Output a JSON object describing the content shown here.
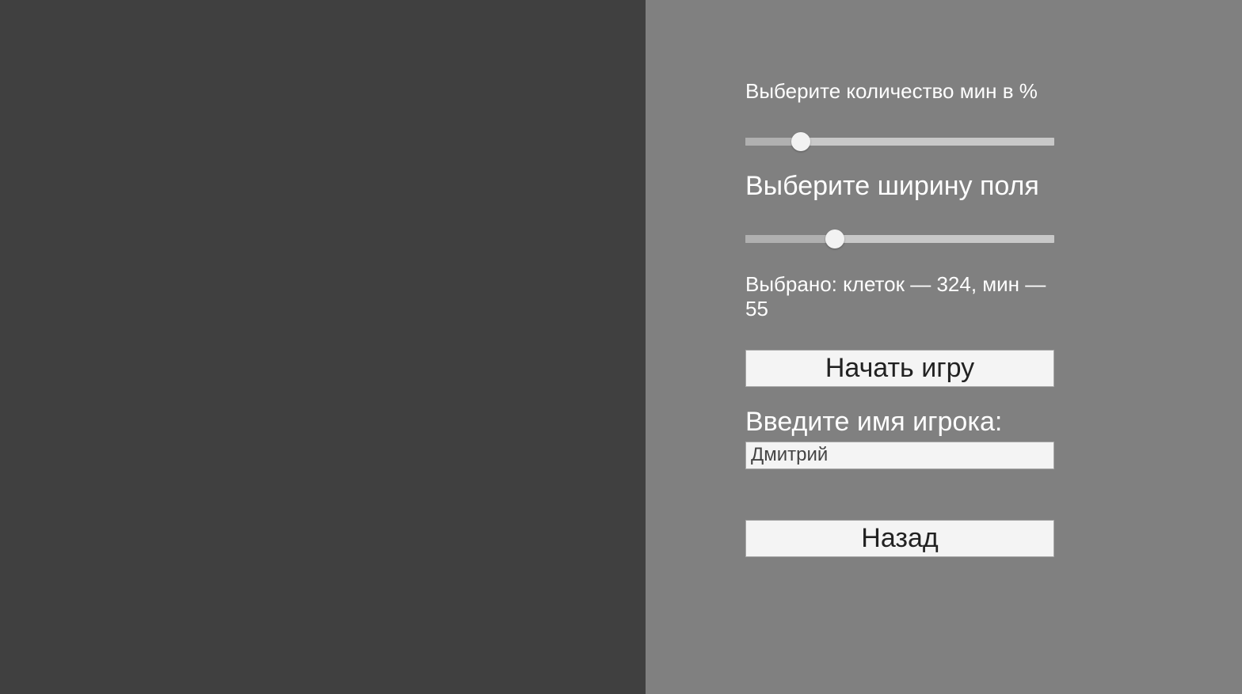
{
  "settings": {
    "mines_percent_label": "Выберите количество мин в %",
    "mines_percent_value_pct": 18,
    "width_label": "Выберите ширину поля",
    "width_value_pct": 29,
    "selected_text": "Выбрано: клеток — 324, мин — 55",
    "cells": 324,
    "mines": 55
  },
  "buttons": {
    "start": "Начать игру",
    "back": "Назад"
  },
  "player": {
    "name_label": "Введите имя игрока:",
    "name_value": "Дмитрий"
  }
}
